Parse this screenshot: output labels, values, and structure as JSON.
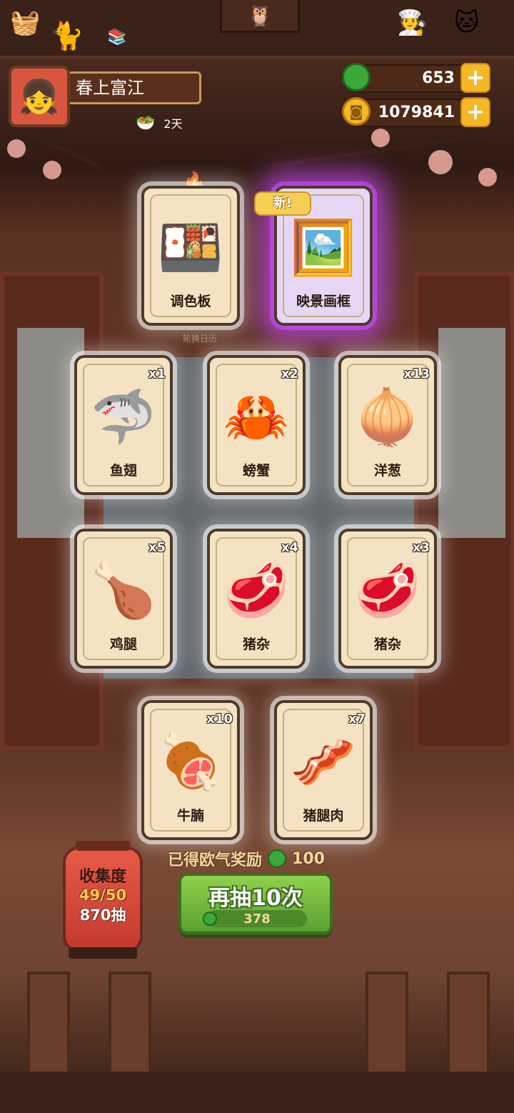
{
  "player": {
    "name": "春上富江",
    "avatar_icon": "player-avatar-icon",
    "days_label": "2天"
  },
  "currencies": {
    "jade": {
      "value": "653",
      "icon": "jade-gem-icon",
      "color": "#3aa83a"
    },
    "coins": {
      "value": "1079841",
      "icon": "gold-coin-icon",
      "color": "#f5b726"
    }
  },
  "decor": {
    "calendar_caption": "轮换日历"
  },
  "cards": [
    {
      "label": "调色板",
      "count": "",
      "icon": "palette-icon",
      "highlight": "normal",
      "is_new": false
    },
    {
      "label": "映景画框",
      "count": "",
      "icon": "picture-frame-icon",
      "highlight": "purple",
      "is_new": true,
      "new_label": "新!"
    },
    {
      "label": "鱼翅",
      "count": "x1",
      "icon": "shark-fin-icon"
    },
    {
      "label": "螃蟹",
      "count": "x2",
      "icon": "crab-icon"
    },
    {
      "label": "洋葱",
      "count": "x13",
      "icon": "onion-icon"
    },
    {
      "label": "鸡腿",
      "count": "x5",
      "icon": "drumstick-icon"
    },
    {
      "label": "猪杂",
      "count": "x4",
      "icon": "pork-offal-icon"
    },
    {
      "label": "猪杂",
      "count": "x3",
      "icon": "pork-offal-icon"
    },
    {
      "label": "牛腩",
      "count": "x10",
      "icon": "beef-brisket-icon"
    },
    {
      "label": "猪腿肉",
      "count": "x7",
      "icon": "pork-leg-icon"
    }
  ],
  "reward": {
    "label": "已得欧气奖励",
    "value": "100"
  },
  "draw_button": {
    "label": "再抽10次",
    "cost": "378"
  },
  "collection": {
    "title": "收集度",
    "progress": "49/50",
    "draws": "870抽"
  }
}
